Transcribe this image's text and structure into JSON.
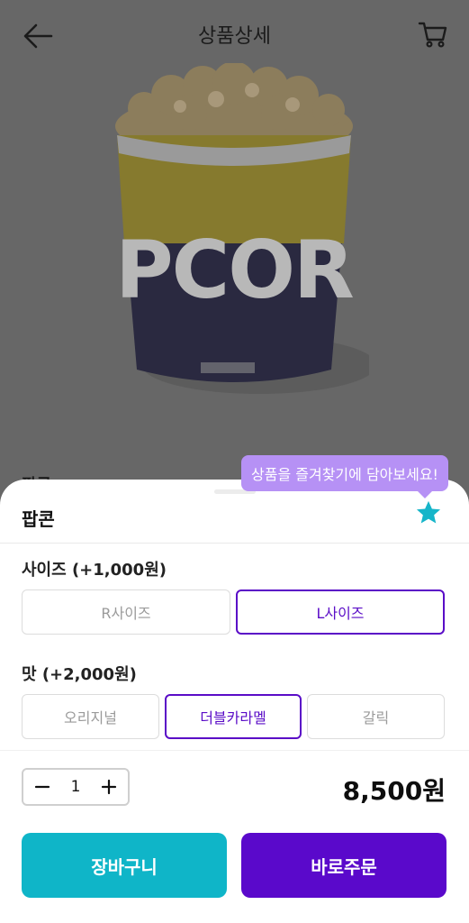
{
  "header": {
    "title": "상품상세"
  },
  "product": {
    "name_behind": "팝콘"
  },
  "favorite_tooltip": "상품을 즐겨찾기에 담아보세요!",
  "sheet": {
    "title": "팝콘",
    "size": {
      "label": "사이즈 (+1,000원)",
      "options": [
        {
          "label": "R사이즈",
          "selected": false
        },
        {
          "label": "L사이즈",
          "selected": true
        }
      ]
    },
    "flavor": {
      "label": "맛 (+2,000원)",
      "options": [
        {
          "label": "오리지널",
          "selected": false
        },
        {
          "label": "더블카라멜",
          "selected": true
        },
        {
          "label": "갈릭",
          "selected": false
        }
      ]
    },
    "quantity": "1",
    "price": "8,500원",
    "cart_button": "장바구니",
    "buy_button": "바로주문"
  },
  "colors": {
    "accent_purple": "#5a09cb",
    "accent_teal": "#0fb5c8",
    "tooltip": "#b691f5",
    "star": "#16b5c9"
  },
  "icons": {
    "back": "arrow-left-icon",
    "cart": "cart-icon",
    "favorite": "star-icon",
    "minus": "minus-icon",
    "plus": "plus-icon"
  }
}
